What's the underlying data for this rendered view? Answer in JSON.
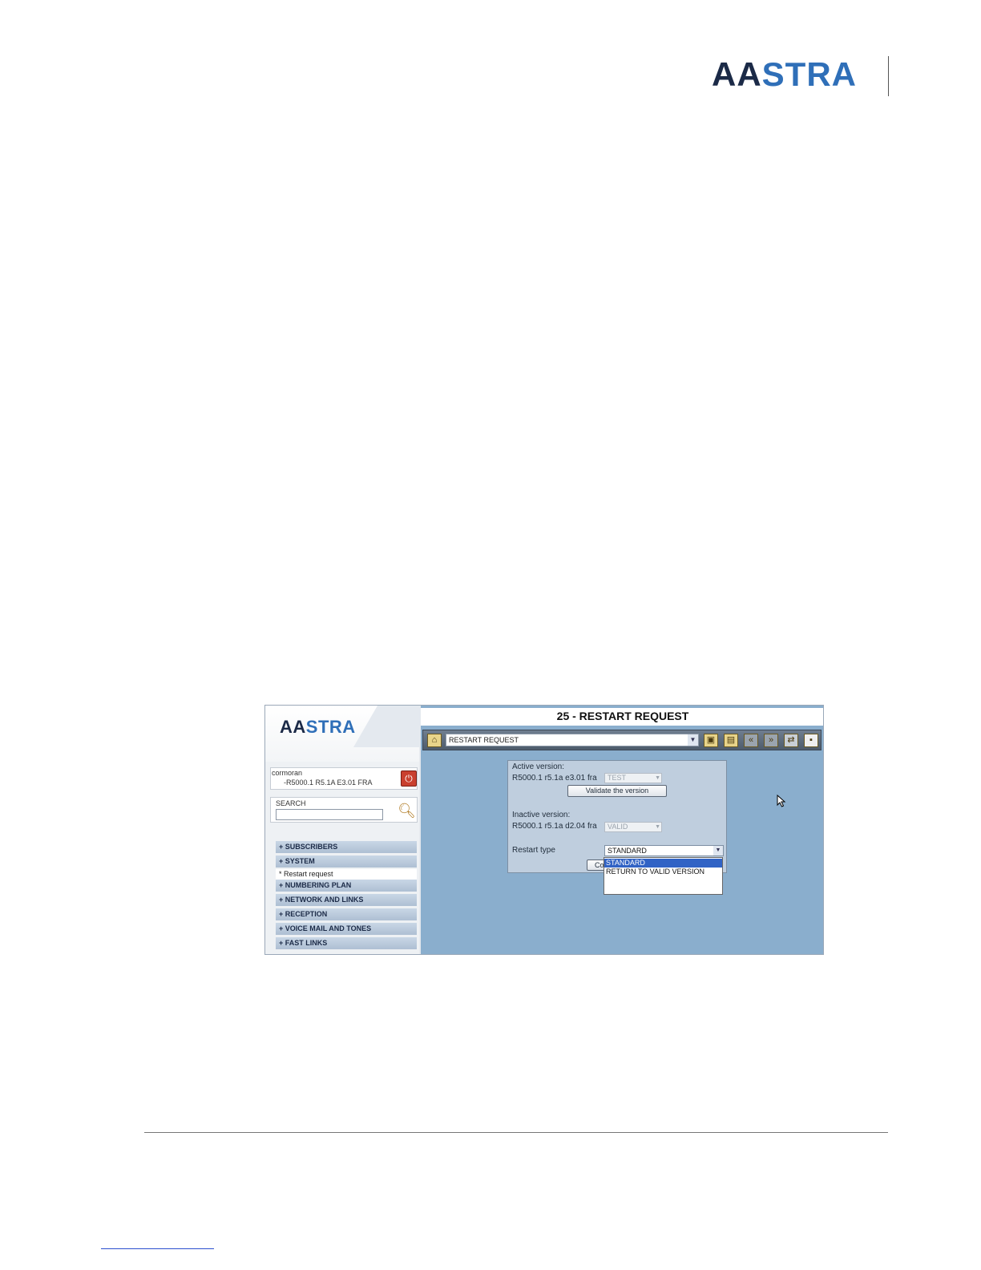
{
  "document": {
    "logo_left": "AA",
    "logo_right": "STRA"
  },
  "app": {
    "logo_left": "AA",
    "logo_right": "STRA",
    "page_title": "25 - RESTART REQUEST",
    "host": {
      "name": "cormoran",
      "version": "-R5000.1 R5.1A E3.01 FRA"
    },
    "search": {
      "label": "SEARCH",
      "value": ""
    },
    "menu": [
      {
        "label": "+ SUBSCRIBERS"
      },
      {
        "label": "+ SYSTEM"
      },
      {
        "label": "+ NUMBERING PLAN"
      },
      {
        "label": "+ NETWORK AND LINKS"
      },
      {
        "label": "+ RECEPTION"
      },
      {
        "label": "+ VOICE MAIL AND TONES"
      },
      {
        "label": "+ FAST LINKS"
      }
    ],
    "submenu": {
      "label": "* Restart request"
    },
    "toolbar": {
      "nav_value": "RESTART REQUEST"
    },
    "form": {
      "active_label": "Active version:",
      "active_version": "R5000.1 r5.1a e3.01 fra",
      "active_status": "TEST",
      "validate_label": "Validate the version",
      "inactive_label": "Inactive version:",
      "inactive_version": "R5000.1 r5.1a d2.04 fra",
      "inactive_status": "VALID",
      "restart_label": "Restart type",
      "restart_value": "STANDARD",
      "confirm_label": "Co",
      "options": [
        "STANDARD",
        "RETURN TO VALID VERSION"
      ]
    }
  },
  "colors": {
    "accent_blue": "#2f6fb8",
    "panel_blue": "#8aaecd",
    "selection": "#3163c5"
  }
}
